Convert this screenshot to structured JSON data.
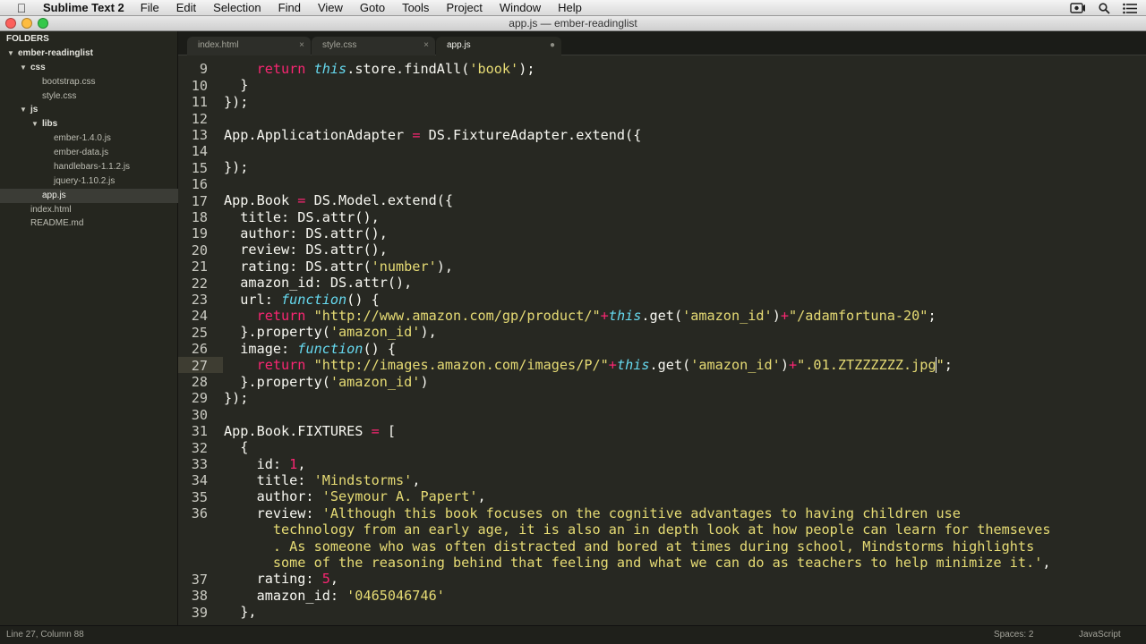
{
  "menubar": {
    "app_name": "Sublime Text 2",
    "items": [
      "File",
      "Edit",
      "Selection",
      "Find",
      "View",
      "Goto",
      "Tools",
      "Project",
      "Window",
      "Help"
    ]
  },
  "window": {
    "title": "app.js — ember-readinglist"
  },
  "sidebar": {
    "header": "FOLDERS",
    "tree": [
      {
        "label": "ember-readinglist",
        "type": "folder",
        "depth": 1
      },
      {
        "label": "css",
        "type": "folder",
        "depth": 2
      },
      {
        "label": "bootstrap.css",
        "type": "file",
        "depth": 3
      },
      {
        "label": "style.css",
        "type": "file",
        "depth": 3
      },
      {
        "label": "js",
        "type": "folder",
        "depth": 2
      },
      {
        "label": "libs",
        "type": "folder",
        "depth": 3
      },
      {
        "label": "ember-1.4.0.js",
        "type": "file",
        "depth": 4
      },
      {
        "label": "ember-data.js",
        "type": "file",
        "depth": 4
      },
      {
        "label": "handlebars-1.1.2.js",
        "type": "file",
        "depth": 4
      },
      {
        "label": "jquery-1.10.2.js",
        "type": "file",
        "depth": 4
      },
      {
        "label": "app.js",
        "type": "file",
        "depth": 3,
        "selected": true
      },
      {
        "label": "index.html",
        "type": "file",
        "depth": 2
      },
      {
        "label": "README.md",
        "type": "file",
        "depth": 2
      }
    ]
  },
  "tabs": [
    {
      "label": "index.html",
      "close": "×"
    },
    {
      "label": "style.css",
      "close": "×"
    },
    {
      "label": "app.js",
      "close": "●",
      "active": true
    }
  ],
  "editor": {
    "line_numbers": [
      "9",
      "10",
      "11",
      "12",
      "13",
      "14",
      "15",
      "16",
      "17",
      "18",
      "19",
      "20",
      "21",
      "22",
      "23",
      "24",
      "25",
      "26",
      "27",
      "28",
      "29",
      "30",
      "31",
      "32",
      "33",
      "34",
      "35",
      "36",
      "",
      "",
      "",
      "37",
      "38",
      "39"
    ]
  },
  "status": {
    "position": "Line 27, Column 88",
    "spaces": "Spaces: 2",
    "syntax": "JavaScript"
  },
  "colors": {
    "keyword": "#f92672",
    "string": "#e6db74",
    "function": "#66d9ef",
    "background": "#272822"
  }
}
